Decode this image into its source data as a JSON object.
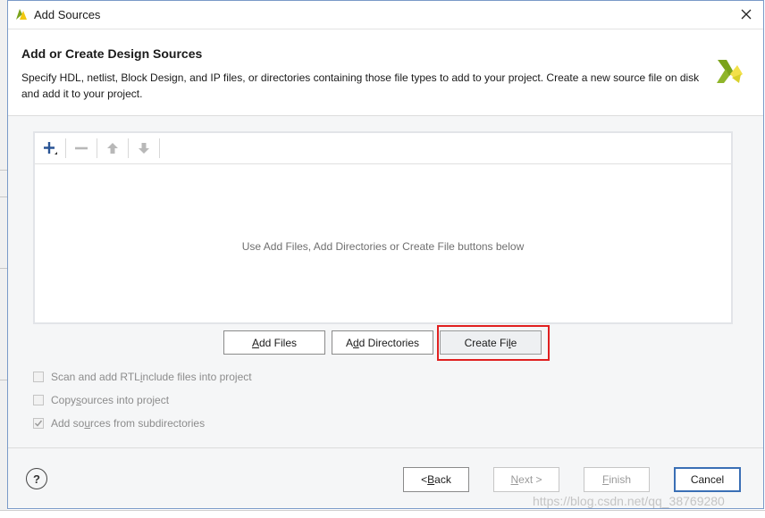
{
  "window": {
    "title": "Add Sources"
  },
  "header": {
    "heading": "Add or Create Design Sources",
    "description": "Specify HDL, netlist, Block Design, and IP files, or directories containing those file types to add to your project. Create a new source file on disk and add it to your project."
  },
  "toolbar": {
    "add_icon": "plus-icon",
    "remove_icon": "minus-icon",
    "move_up_icon": "arrow-up-icon",
    "move_down_icon": "arrow-down-icon"
  },
  "file_list": {
    "empty_message": "Use Add Files, Add Directories or Create File buttons below"
  },
  "actions": {
    "add_files": {
      "mnemonic": "A",
      "rest": "dd Files"
    },
    "add_directories": {
      "pre": "A",
      "mnemonic": "d",
      "rest": "d Directories"
    },
    "create_file": {
      "pre": "Create Fi",
      "mnemonic": "l",
      "rest": "e"
    }
  },
  "options": {
    "scan_rtl": {
      "pre": "Scan and add RTL ",
      "mnemonic": "i",
      "rest": "nclude files into project",
      "checked": false
    },
    "copy_sources": {
      "pre": "Copy ",
      "mnemonic": "s",
      "rest": "ources into project",
      "checked": false
    },
    "subdirectories": {
      "pre": "Add so",
      "mnemonic": "u",
      "rest": "rces from subdirectories",
      "checked": true
    }
  },
  "footer": {
    "help": "?",
    "back": {
      "pre": "< ",
      "mnemonic": "B",
      "rest": "ack"
    },
    "next": {
      "mnemonic": "N",
      "rest": "ext >"
    },
    "finish": {
      "mnemonic": "F",
      "rest": "inish"
    },
    "cancel": "Cancel"
  },
  "watermark": "https://blog.csdn.net/qq_38769280",
  "colors": {
    "highlight_border": "#e02020",
    "cancel_border": "#3a6fb5",
    "logo_green": "#7aa31b",
    "logo_yellow": "#f2c80f"
  }
}
